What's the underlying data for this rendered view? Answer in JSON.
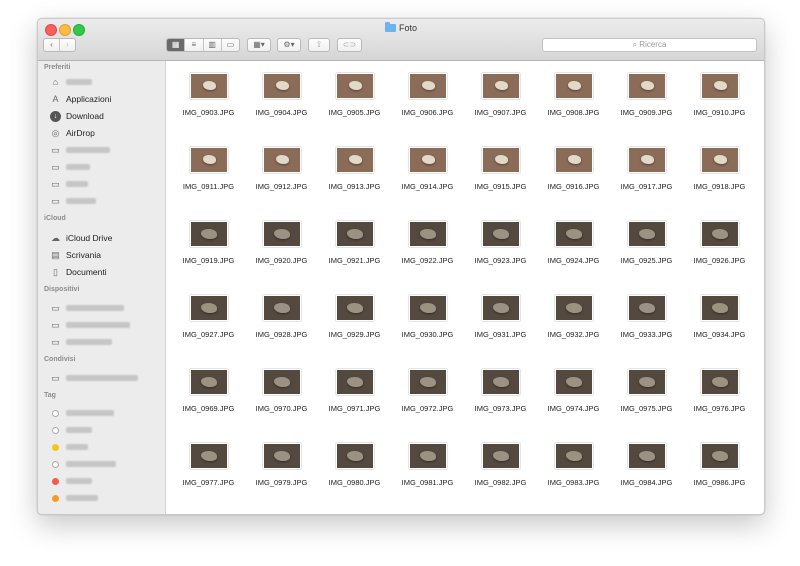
{
  "window": {
    "title": "Foto"
  },
  "toolbar": {
    "back_icon": "chevron-left-icon",
    "forward_icon": "chevron-right-icon",
    "view_modes": [
      "icon-view",
      "list-view",
      "column-view",
      "cover-flow-view"
    ],
    "active_view": "icon-view",
    "search_placeholder": "Ricerca"
  },
  "sidebar": {
    "favorites_header": "Preferiti",
    "favorites": [
      {
        "label": "",
        "icon": "home-icon",
        "blurred": true
      },
      {
        "label": "Applicazioni",
        "icon": "applications-icon"
      },
      {
        "label": "Download",
        "icon": "download-icon"
      },
      {
        "label": "AirDrop",
        "icon": "airdrop-icon"
      },
      {
        "label": "",
        "icon": "folder-icon",
        "blurred": true
      },
      {
        "label": "",
        "icon": "folder-icon",
        "blurred": true
      },
      {
        "label": "",
        "icon": "folder-icon",
        "blurred": true
      },
      {
        "label": "",
        "icon": "folder-icon",
        "blurred": true
      }
    ],
    "icloud_header": "iCloud",
    "icloud": [
      {
        "label": "iCloud Drive",
        "icon": "cloud-icon"
      },
      {
        "label": "Scrivania",
        "icon": "desktop-icon"
      },
      {
        "label": "Documenti",
        "icon": "document-icon"
      }
    ],
    "devices_header": "Dispositivi",
    "shared_header": "Condivisi",
    "tags_header": "Tag",
    "tag_colors": [
      "#ffffff",
      "#ffffff",
      "#f5c518",
      "#ffffff",
      "#f25a52",
      "#f59b2a"
    ]
  },
  "files": [
    "IMG_0903.JPG",
    "IMG_0904.JPG",
    "IMG_0905.JPG",
    "IMG_0906.JPG",
    "IMG_0907.JPG",
    "IMG_0908.JPG",
    "IMG_0909.JPG",
    "IMG_0910.JPG",
    "IMG_0911.JPG",
    "IMG_0912.JPG",
    "IMG_0913.JPG",
    "IMG_0914.JPG",
    "IMG_0915.JPG",
    "IMG_0916.JPG",
    "IMG_0917.JPG",
    "IMG_0918.JPG",
    "IMG_0919.JPG",
    "IMG_0920.JPG",
    "IMG_0921.JPG",
    "IMG_0922.JPG",
    "IMG_0923.JPG",
    "IMG_0924.JPG",
    "IMG_0925.JPG",
    "IMG_0926.JPG",
    "IMG_0927.JPG",
    "IMG_0928.JPG",
    "IMG_0929.JPG",
    "IMG_0930.JPG",
    "IMG_0931.JPG",
    "IMG_0932.JPG",
    "IMG_0933.JPG",
    "IMG_0934.JPG",
    "IMG_0969.JPG",
    "IMG_0970.JPG",
    "IMG_0971.JPG",
    "IMG_0972.JPG",
    "IMG_0973.JPG",
    "IMG_0974.JPG",
    "IMG_0975.JPG",
    "IMG_0976.JPG",
    "IMG_0977.JPG",
    "IMG_0979.JPG",
    "IMG_0980.JPG",
    "IMG_0981.JPG",
    "IMG_0982.JPG",
    "IMG_0983.JPG",
    "IMG_0984.JPG",
    "IMG_0986.JPG"
  ]
}
